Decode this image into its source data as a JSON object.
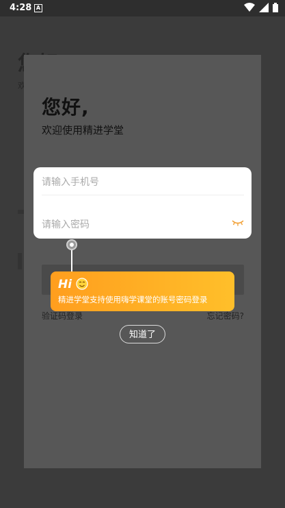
{
  "status_bar": {
    "time": "4:28",
    "notification_glyph": "A",
    "icons": [
      "wifi-icon",
      "signal-icon",
      "battery-icon"
    ]
  },
  "background_page": {
    "heading": "您好",
    "subtitle": "欢"
  },
  "sheet": {
    "greeting": "您好,",
    "welcome": "欢迎使用精进学堂",
    "code_login": "验证码登录",
    "forgot_password": "忘记密码?"
  },
  "form": {
    "phone_placeholder": "请输入手机号",
    "password_placeholder": "请输入密码",
    "eye_icon": "eye-closed-icon"
  },
  "tooltip": {
    "hi": "Hi",
    "emoji": "smile-icon",
    "text": "精进学堂支持使用嗨学课堂的账号密码登录"
  },
  "got_it_label": "知道了",
  "colors": {
    "accent": "#ffaa22",
    "overlay": "#2f2f2f",
    "sheet": "#575757"
  }
}
